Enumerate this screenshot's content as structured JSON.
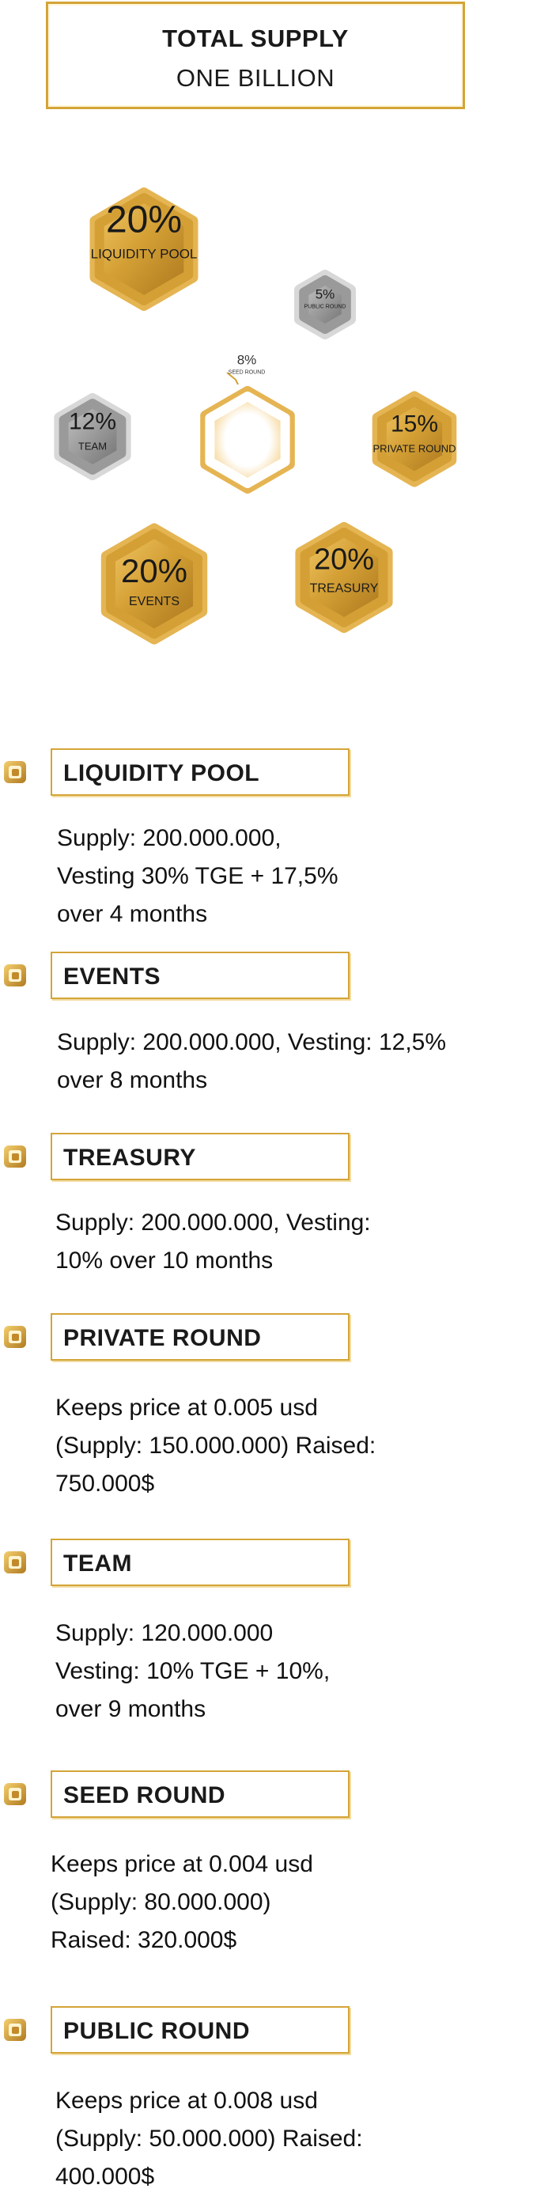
{
  "header": {
    "title": "TOTAL SUPPLY",
    "subtitle": "ONE BILLION"
  },
  "colors": {
    "gold": "#d4a437",
    "gold_dark": "#a8741c",
    "gold_light": "#f2c766",
    "gray": "#8a8a8a",
    "gray_light": "#b5b5b5"
  },
  "hexagons": [
    {
      "pct": "20%",
      "name": "LIQUIDITY POOL",
      "style": "gold"
    },
    {
      "pct": "5%",
      "name": "PUBLIC ROUND",
      "style": "gray"
    },
    {
      "pct": "8%",
      "name": "SEED ROUND",
      "style": "white"
    },
    {
      "pct": "12%",
      "name": "TEAM",
      "style": "gray"
    },
    {
      "pct": "15%",
      "name": "PRIVATE ROUND",
      "style": "gold"
    },
    {
      "pct": "20%",
      "name": "EVENTS",
      "style": "gold"
    },
    {
      "pct": "20%",
      "name": "TREASURY",
      "style": "gold"
    }
  ],
  "sections": [
    {
      "title": "LIQUIDITY POOL",
      "lines": [
        "Supply: 200.000.000,",
        "Vesting 30% TGE + 17,5%",
        "over 4 months"
      ]
    },
    {
      "title": "EVENTS",
      "lines": [
        "Supply: 200.000.000,  Vesting: 12,5%",
        "over 8 months"
      ]
    },
    {
      "title": "TREASURY",
      "lines": [
        "Supply: 200.000.000, Vesting:",
        "10% over 10 months"
      ]
    },
    {
      "title": "PRIVATE ROUND",
      "lines": [
        "Keeps price at 0.005 usd",
        "(Supply: 150.000.000) Raised:",
        "750.000$"
      ]
    },
    {
      "title": "TEAM",
      "lines": [
        "Supply: 120.000.000",
        "Vesting: 10% TGE + 10%,",
        "over 9 months"
      ]
    },
    {
      "title": "SEED ROUND",
      "lines": [
        "Keeps price at 0.004 usd",
        "(Supply: 80.000.000)",
        "Raised: 320.000$"
      ]
    },
    {
      "title": "PUBLIC ROUND",
      "lines": [
        "Keeps price at 0.008 usd",
        "(Supply: 50.000.000) Raised:",
        "400.000$"
      ]
    }
  ],
  "icons": {
    "section_marker": "gold-coin-icon"
  }
}
